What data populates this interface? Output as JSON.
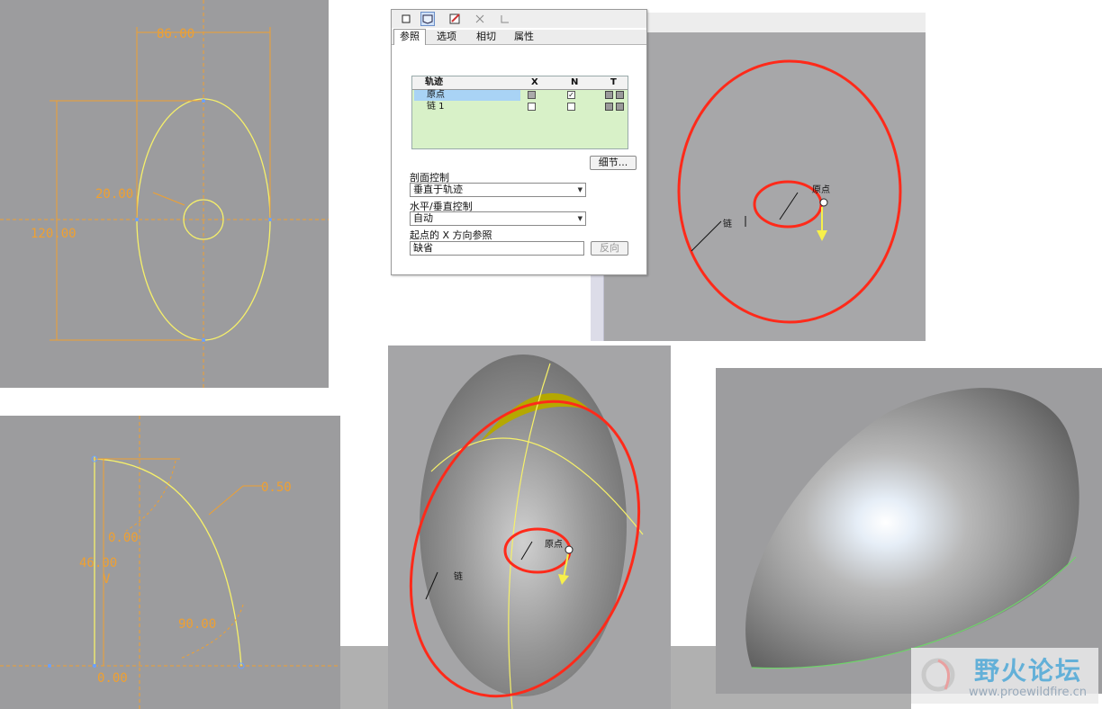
{
  "sketch_top_left": {
    "dim_width": "86.00",
    "dim_height": "120.00",
    "dim_circle": "20.00"
  },
  "sketch_bottom_left": {
    "dim_top": "0.50",
    "dim_mid": "0.00",
    "dim_left": "46.00",
    "dim_angle": "90.00",
    "dim_bottom": "0.00",
    "axis_label": "V"
  },
  "dialog": {
    "tabs": [
      "参照",
      "选项",
      "相切",
      "属性"
    ],
    "table": {
      "headers": [
        "轨迹",
        "X",
        "N",
        "T"
      ],
      "rows": [
        {
          "name": "原点",
          "x": false,
          "n": true
        },
        {
          "name": "链 1",
          "x": false,
          "n": false
        }
      ]
    },
    "details_button": "细节...",
    "section_label": "剖面控制",
    "section_value": "垂直于轨迹",
    "hv_label": "水平/垂直控制",
    "hv_value": "自动",
    "xref_label": "起点的 X 方向参照",
    "xref_value": "缺省",
    "flip_button": "反向"
  },
  "view_top_right": {
    "origin_label": "原点",
    "chain_label": "链"
  },
  "view_bottom_mid": {
    "origin_label": "原点",
    "chain_label": "链"
  },
  "watermark": {
    "title": "野火论坛",
    "url": "www.proewildfire.cn"
  },
  "colors": {
    "sketch_bg": "#9c9c9e",
    "sketch_line": "#f6f06a",
    "dim": "#f0a030",
    "trajectory": "#ff2a1a",
    "surface": "#8a8a8a"
  }
}
